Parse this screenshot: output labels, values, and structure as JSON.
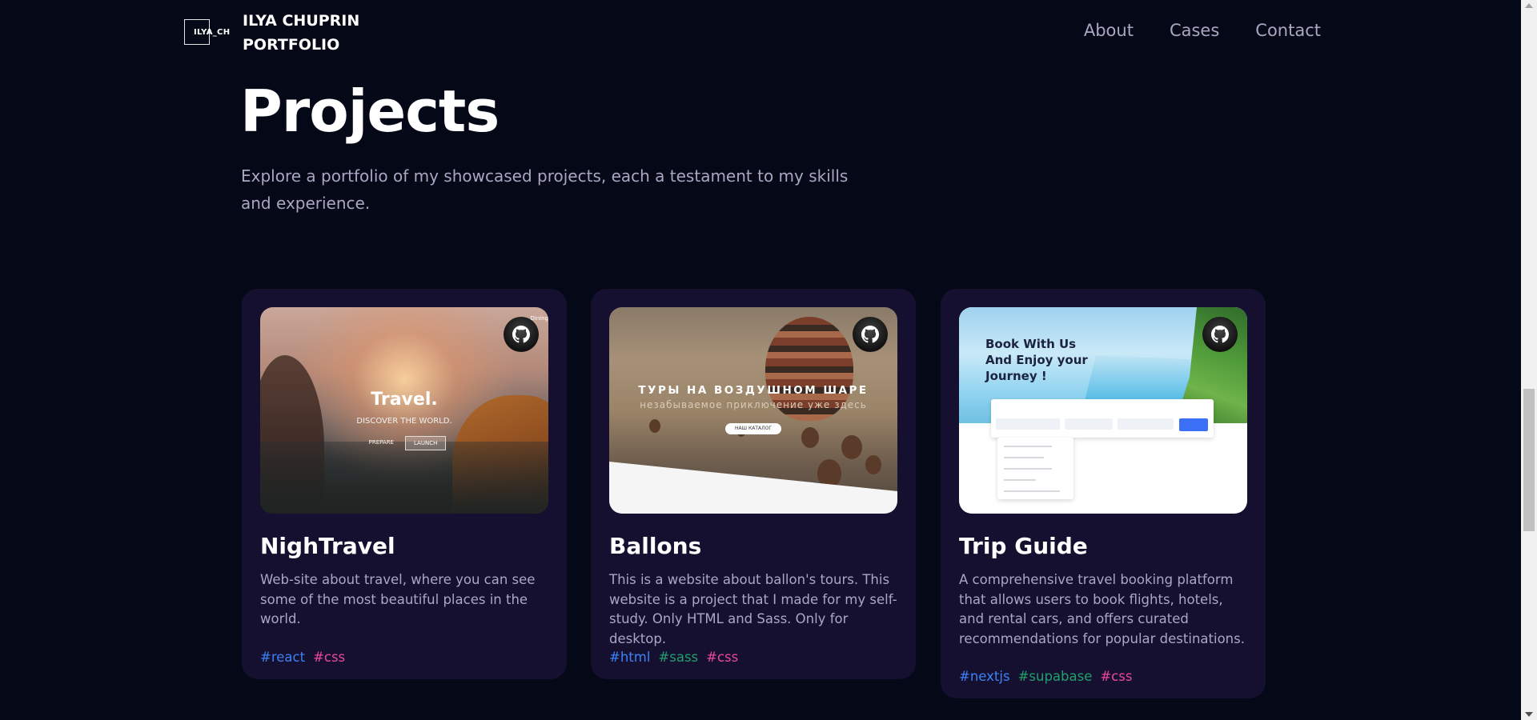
{
  "brand": {
    "logo_text": "ILYA_CH",
    "name_line1": "ILYA CHUPRIN",
    "name_line2": "PORTFOLIO"
  },
  "nav": {
    "links": [
      "About",
      "Cases",
      "Contact"
    ]
  },
  "page": {
    "title": "Projects",
    "description": "Explore a portfolio of my showcased projects, each a testament to my skills and experience."
  },
  "projects": [
    {
      "title": "NighTravel",
      "description": "Web-site about travel, where you can see some of the most beautiful places in the world.",
      "tags": [
        "#react",
        "#css"
      ],
      "preview": {
        "headline": "Travel.",
        "subline": "DISCOVER THE WORLD.",
        "button1": "PREPARE",
        "button2": "LAUNCH",
        "topnav": "Dining"
      }
    },
    {
      "title": "Ballons",
      "description": "This is a website about ballon's tours. This website is a project that I made for my self-study. Only HTML and Sass. Only for desktop.",
      "tags": [
        "#html",
        "#sass",
        "#css"
      ],
      "preview": {
        "headline": "ТУРЫ НА ВОЗДУШНОМ ШАРЕ",
        "subline": "незабываемое приключение уже здесь",
        "button": "НАШ КАТАЛОГ"
      }
    },
    {
      "title": "Trip Guide",
      "description": "A comprehensive travel booking platform that allows users to book flights, hotels, and rental cars, and offers curated recommendations for popular destinations.",
      "tags": [
        "#nextjs",
        "#supabase",
        "#css"
      ],
      "preview": {
        "headline": "Book With Us And Enjoy your Journey !"
      }
    }
  ],
  "colors": {
    "background": "#050816",
    "card": "#151030",
    "secondary_text": "#aaa6c3",
    "tag_blue": "#3b82f6",
    "tag_green": "#22a06b",
    "tag_pink": "#ec4899"
  },
  "icons": {
    "github": "github-icon"
  }
}
